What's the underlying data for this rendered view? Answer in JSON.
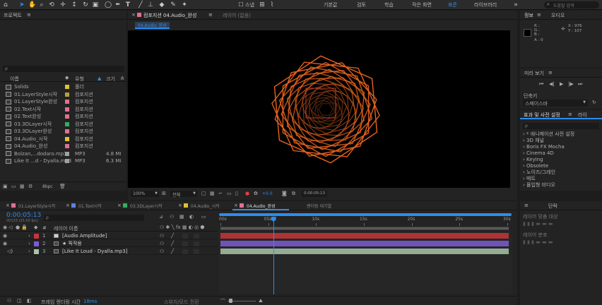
{
  "colors": {
    "accent": "#2d8ceb",
    "orange": "#e8641e",
    "timecode": "#2d8ceb",
    "layer_red": "#c8353b",
    "layer_purple": "#7c5cd6",
    "layer_green": "#a8c4a8"
  },
  "toolbar": {
    "snap_label": "스냅",
    "workspaces": [
      "기본값",
      "검토",
      "학습",
      "작은 화면",
      "표준",
      "라이브러리"
    ],
    "active_workspace_index": 4,
    "search_placeholder": "도움말 검색"
  },
  "project": {
    "title": "프로젝트",
    "search_placeholder": "ρ",
    "columns": {
      "name": "이름",
      "type": "유형",
      "size": "크기"
    },
    "items": [
      {
        "name": "Solids",
        "type": "폴더",
        "size": "",
        "color": "#e0c030",
        "icon": "folder-icon"
      },
      {
        "name": "01.LayerStyle시작",
        "type": "컴포지션",
        "size": "",
        "color": "#b0a040",
        "icon": "composition-icon"
      },
      {
        "name": "01.LayerStyle완성",
        "type": "컴포지션",
        "size": "",
        "color": "#e07090",
        "icon": "composition-icon"
      },
      {
        "name": "02.Text시작",
        "type": "컴포지션",
        "size": "",
        "color": "#e07090",
        "icon": "composition-icon"
      },
      {
        "name": "02.Text완성",
        "type": "컴포지션",
        "size": "",
        "color": "#e07090",
        "icon": "composition-icon"
      },
      {
        "name": "03.3DLayer시작",
        "type": "컴포지션",
        "size": "",
        "color": "#30b060",
        "icon": "composition-icon"
      },
      {
        "name": "03.3DLayer완성",
        "type": "컴포지션",
        "size": "",
        "color": "#e07090",
        "icon": "composition-icon"
      },
      {
        "name": "04.Audio_시작",
        "type": "컴포지션",
        "size": "",
        "color": "#e0c030",
        "icon": "composition-icon"
      },
      {
        "name": "04.Audio_완성",
        "type": "컴포지션",
        "size": "",
        "color": "#e07090",
        "icon": "composition-icon"
      },
      {
        "name": "Bolzan,...dodaro.mp3",
        "type": "MP3",
        "size": "4.8 MI",
        "color": "#a0a0a0",
        "icon": "audio-icon"
      },
      {
        "name": "Like It ...d - Dyalla.mp3",
        "type": "MP3",
        "size": "6.3 MI",
        "color": "#a0a0a0",
        "icon": "audio-icon"
      }
    ],
    "footer_bpc": "8bpc"
  },
  "composition": {
    "tab_label": "컴포지션 04.Audio_완성",
    "tab2_label": "레이어 (없음)",
    "breadcrumb": "04.Audio_완성",
    "zoom": "100%",
    "resolution": "전체",
    "exposure": "+0.0",
    "timecode": "0:00:05:13"
  },
  "info": {
    "tab_label": "정보",
    "tab2_label": "오디오",
    "r": "R :",
    "g": "G :",
    "b": "B :",
    "a": "A : 0",
    "x": "X : 976",
    "y": "Y : 107"
  },
  "preview": {
    "title": "미리 보기",
    "shortcut_label": "단축키",
    "shortcut_value": "스페이스바"
  },
  "effects": {
    "title": "효과 및 사전 설정",
    "tab2": "라이",
    "search_placeholder": "ρ",
    "items": [
      "* 애니메이션 사전 설정",
      "3D 채널",
      "Boris FX Mocha",
      "Cinema 4D",
      "Keying",
      "Obsolete",
      "노이즈/그레인",
      "매트",
      "몰입형 비디오"
    ]
  },
  "align": {
    "title": "단락",
    "align_to_label": "레이어 맞춤 대상",
    "distribute_label": "레이어 분포"
  },
  "timeline": {
    "tabs": [
      "01.LayerStyle시작",
      "01.Text시작",
      "03.3DLayer시작",
      "04.Audio_시작",
      "04.Audio_완성",
      "렌더링 대기열"
    ],
    "tab_colors": [
      "#e07090",
      "#6080e0",
      "#30b060",
      "#e0c030",
      "#e07090",
      "#808080"
    ],
    "active_tab_index": 4,
    "timecode": "0:00:05:13",
    "timecode_sub": "00133 (25.00 fps)",
    "search_placeholder": "ρ",
    "columns": {
      "num": "#",
      "layer_name": "레이어 이름"
    },
    "ruler_labels": [
      "00s",
      "05s",
      "10s",
      "15s",
      "20s",
      "25s",
      "30s"
    ],
    "playhead_seconds": 5.52,
    "duration_seconds": 30,
    "layers": [
      {
        "num": "1",
        "name": "[Audio Amplitude]",
        "color": "#c8353b",
        "icon": "solid-icon"
      },
      {
        "num": "2",
        "name": "★ 픽작용",
        "color": "#7c5cd6",
        "icon": "shape-icon"
      },
      {
        "num": "3",
        "name": "[Like It Loud - Dyalla.mp3]",
        "color": "#a8c4a8",
        "icon": "audio-icon"
      }
    ],
    "footer_label": "프레임 렌더링 시간",
    "footer_value": "18ms",
    "footer_toggle": "스위치/모드 전환"
  }
}
